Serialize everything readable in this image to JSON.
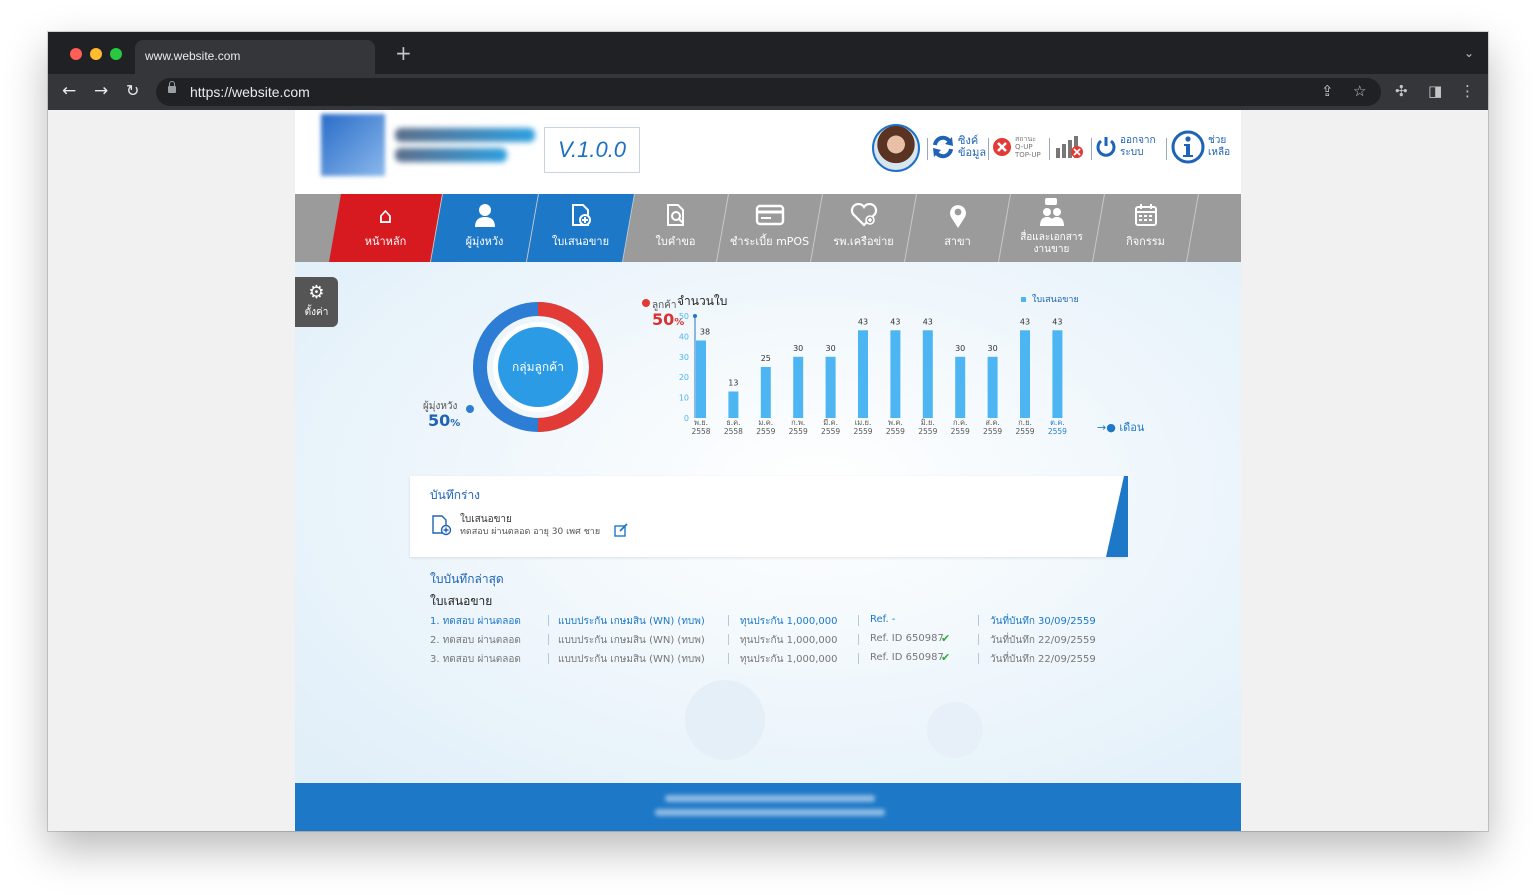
{
  "browser": {
    "tab_title": "www.website.com",
    "new_tab": "+",
    "url": "https://website.com"
  },
  "header": {
    "version": "V.1.0.0",
    "sync_label_1": "ซิงค์",
    "sync_label_2": "ข้อมูล",
    "status_label_1": "สถานะ",
    "status_label_2": "Q-UP",
    "status_label_3": "TOP-UP",
    "logout_label_1": "ออกจาก",
    "logout_label_2": "ระบบ",
    "help_label_1": "ช่วย",
    "help_label_2": "เหลือ"
  },
  "menu": {
    "items": [
      {
        "label": "หน้าหลัก",
        "icon": "home-icon",
        "glyph": "⌂"
      },
      {
        "label": "ผู้มุ่งหวัง",
        "icon": "person-icon",
        "glyph": "👤"
      },
      {
        "label": "ใบเสนอขาย",
        "icon": "document-add-icon",
        "glyph": "🗋"
      },
      {
        "label": "ใบคำขอ",
        "icon": "document-search-icon",
        "glyph": "🔍"
      },
      {
        "label": "ชำระเบี้ย mPOS",
        "icon": "card-icon",
        "glyph": "💳"
      },
      {
        "label": "รพ.เครือข่าย",
        "icon": "heart-icon",
        "glyph": "♡"
      },
      {
        "label": "สาขา",
        "icon": "location-icon",
        "glyph": "📍"
      },
      {
        "label_1": "สื่อและเอกสาร",
        "label_2": "งานขาย",
        "icon": "media-icon",
        "glyph": "👥"
      },
      {
        "label": "กิจกรรม",
        "icon": "calendar-icon",
        "glyph": "📅"
      }
    ],
    "active_color": "#d71920",
    "selected_color": "#1e78c8",
    "bg_color": "#9b9b9b"
  },
  "settings": {
    "label": "ตั้งค่า"
  },
  "donut": {
    "center_label": "กลุ่มลูกค้า",
    "customer_label": "ลูกค้า",
    "customer_pct": "50",
    "prospect_label": "ผู้มุ่งหวัง",
    "prospect_pct": "50",
    "pct_sign": "%",
    "customer_color": "#e23a35",
    "prospect_color": "#2c7dd3",
    "center_color": "#2b9be5"
  },
  "chart_data": {
    "type": "bar",
    "title": "จำนวนใบ",
    "legend": "ใบเสนอขาย",
    "xlabel": "เดือน",
    "ylim": [
      0,
      50
    ],
    "yticks": [
      0,
      10,
      20,
      30,
      40,
      50
    ],
    "categories": [
      [
        "พ.ย.",
        "2558"
      ],
      [
        "ธ.ค.",
        "2558"
      ],
      [
        "ม.ค.",
        "2559"
      ],
      [
        "ก.พ.",
        "2559"
      ],
      [
        "มี.ค.",
        "2559"
      ],
      [
        "เม.ย.",
        "2559"
      ],
      [
        "พ.ค.",
        "2559"
      ],
      [
        "มิ.ย.",
        "2559"
      ],
      [
        "ก.ค.",
        "2559"
      ],
      [
        "ส.ค.",
        "2559"
      ],
      [
        "ก.ย.",
        "2559"
      ],
      [
        "ต.ค.",
        "2559"
      ]
    ],
    "values": [
      38,
      13,
      25,
      30,
      30,
      43,
      43,
      43,
      30,
      30,
      43,
      43
    ],
    "bar_color": "#4db6f2",
    "highlight_last_color": "#2c7dd3"
  },
  "draft": {
    "title": "บันทึกร่าง",
    "item_type": "ใบเสนอขาย",
    "item_desc": "ทดสอบ ผ่านตลอด อายุ 30 เพศ ชาย"
  },
  "recent": {
    "title": "ใบบันทึกล่าสุด",
    "subtitle": "ใบเสนอขาย",
    "rows": [
      {
        "name": "1. ทดสอบ ผ่านตลอด",
        "plan": "แบบประกัน เกษมสิน (WN) (ทบพ)",
        "sum": "ทุนประกัน 1,000,000",
        "ref": "Ref. -",
        "check": "",
        "date": "วันที่บันทึก 30/09/2559"
      },
      {
        "name": "2. ทดสอบ ผ่านตลอด",
        "plan": "แบบประกัน เกษมสิน (WN) (ทบพ)",
        "sum": "ทุนประกัน 1,000,000",
        "ref": "Ref. ID 650987",
        "check": "✔",
        "date": "วันที่บันทึก 22/09/2559"
      },
      {
        "name": "3. ทดสอบ ผ่านตลอด",
        "plan": "แบบประกัน เกษมสิน (WN) (ทบพ)",
        "sum": "ทุนประกัน 1,000,000",
        "ref": "Ref. ID 650987",
        "check": "✔",
        "date": "วันที่บันทึก 22/09/2559"
      }
    ]
  }
}
